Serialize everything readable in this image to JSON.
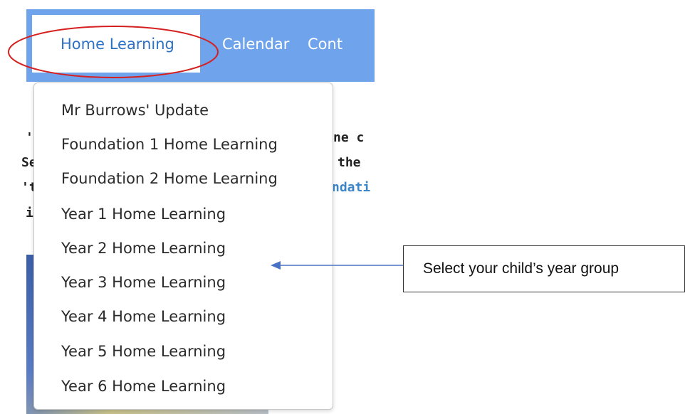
{
  "navbar": {
    "items": [
      {
        "label": "Home Learning",
        "active": true
      },
      {
        "label": "Calendar"
      },
      {
        "label": "Cont"
      }
    ],
    "color": "#6fa3ec",
    "active_text_color": "#2e72c4"
  },
  "background_text": {
    "lines": [
      "'",
      "ne c",
      "Se",
      "the",
      "'t",
      "ndati",
      "i"
    ]
  },
  "dropdown": {
    "items": [
      "Mr Burrows' Update",
      "Foundation 1 Home Learning",
      "Foundation 2 Home Learning",
      "Year 1 Home Learning",
      "Year 2 Home Learning",
      "Year 3 Home Learning",
      "Year 4 Home Learning",
      "Year 5 Home Learning",
      "Year 6 Home Learning"
    ]
  },
  "annotation": {
    "callout_text": "Select your child’s year group",
    "oval_color": "#d62020",
    "arrow_color": "#4a72c4"
  }
}
